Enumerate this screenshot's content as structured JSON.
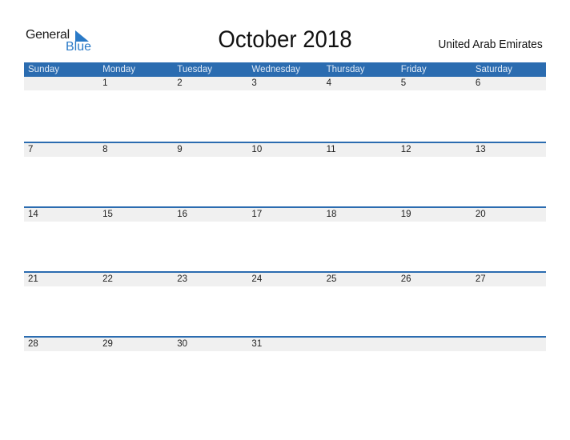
{
  "logo": {
    "word1": "General",
    "word2": "Blue",
    "icon": "triangle-flag-icon"
  },
  "title": "October 2018",
  "country": "United Arab Emirates",
  "colors": {
    "header_bg": "#2b6cb0",
    "date_strip_bg": "#f0f0f0",
    "brand_blue": "#2a7ac7"
  },
  "weekdays": [
    "Sunday",
    "Monday",
    "Tuesday",
    "Wednesday",
    "Thursday",
    "Friday",
    "Saturday"
  ],
  "weeks": [
    [
      "",
      "1",
      "2",
      "3",
      "4",
      "5",
      "6"
    ],
    [
      "7",
      "8",
      "9",
      "10",
      "11",
      "12",
      "13"
    ],
    [
      "14",
      "15",
      "16",
      "17",
      "18",
      "19",
      "20"
    ],
    [
      "21",
      "22",
      "23",
      "24",
      "25",
      "26",
      "27"
    ],
    [
      "28",
      "29",
      "30",
      "31",
      "",
      "",
      ""
    ]
  ]
}
